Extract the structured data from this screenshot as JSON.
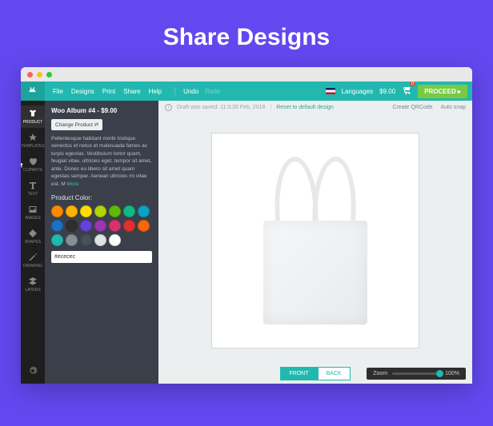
{
  "hero": {
    "title": "Share Designs"
  },
  "menu": {
    "file": "File",
    "designs": "Designs",
    "print": "Print",
    "share": "Share",
    "help": "Help",
    "undo": "Undo",
    "redo": "Redo"
  },
  "topbar": {
    "languages": "Languages",
    "price": "$9.00",
    "cart_count": "0",
    "proceed": "PROCEED ▸"
  },
  "iconcol": {
    "product": "PRODUCT",
    "templates": "TEMPLATES",
    "cliparts": "CLIPARTS",
    "text": "TEXT",
    "images": "IMAGES",
    "shapes": "SHAPES",
    "drawing": "DRAWING",
    "layers": "LAYERS"
  },
  "panel": {
    "title": "Woo Album #4 - $9.00",
    "change": "Change Product ⇄",
    "lorem": "Pellentesque habitant morbi tristique senectus et netus et malesuada fames ac turpis egestas. Vestibulum tortor quam, feugiat vitae, ultricies eget, tempor sit amet, ante. Donec eu libero sit amet quam egestas semper. Aenean ultricies mi vitae est. M ",
    "more": "More",
    "pc_label": "Product Color:",
    "swatches": [
      "#ff8a00",
      "#ffb400",
      "#ffde00",
      "#b0d500",
      "#5fb90a",
      "#12b886",
      "#0aa2c0",
      "#1971c2",
      "#2e2e2e",
      "#6741d9",
      "#9c36b5",
      "#d6336c",
      "#e03131",
      "#f76707",
      "#22b8af",
      "#868e96",
      "#495057",
      "#dee2e6",
      "#ffffff"
    ],
    "hex": "#ececec"
  },
  "canvas": {
    "info_icon": "i",
    "saved": "Draft was saved: 11:3:26 Feb, 2018",
    "reset": "Reset to default design",
    "qrcode": "Create QRCode",
    "autosnap": "Auto snap"
  },
  "footer": {
    "front": "FRONT",
    "back": "BACK",
    "zoom_label": "Zoom",
    "zoom_value": "100%"
  }
}
